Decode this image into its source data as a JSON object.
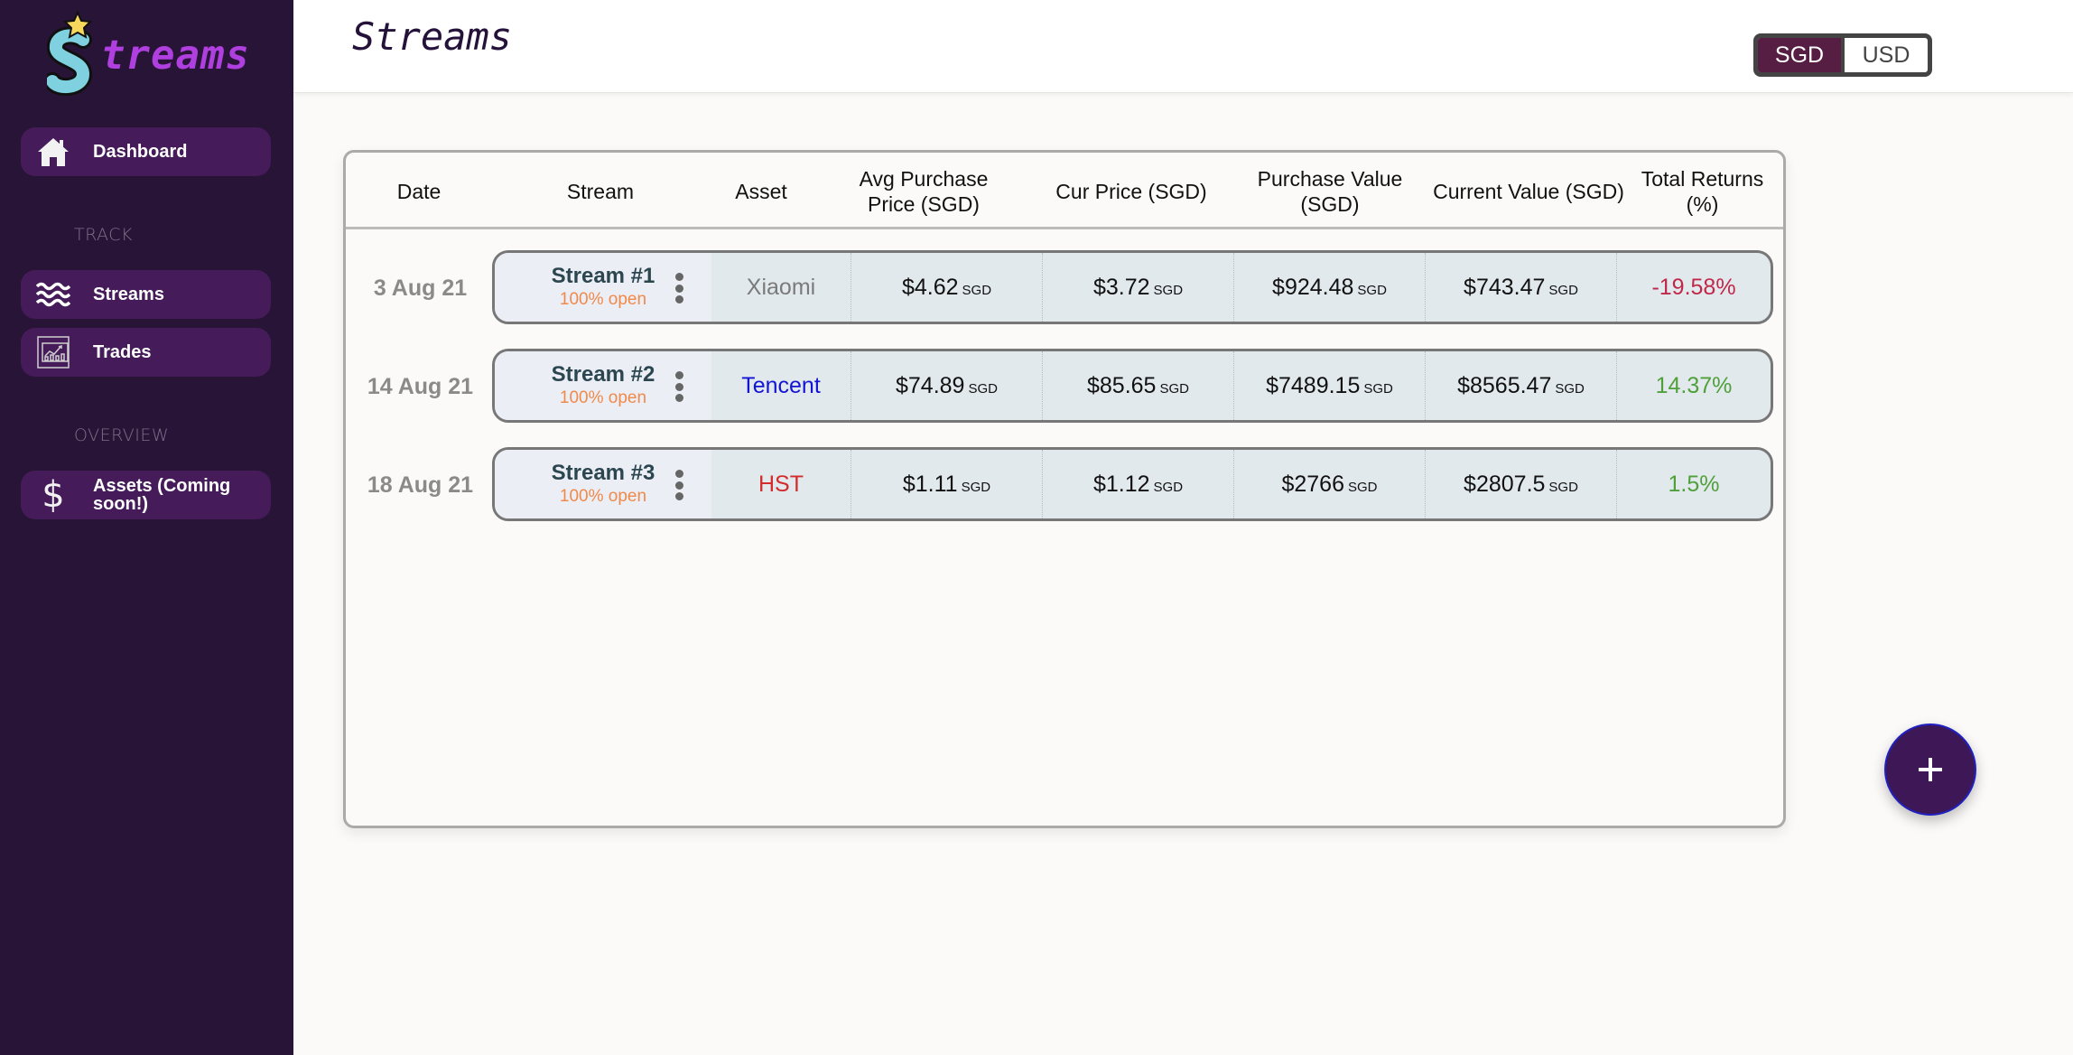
{
  "app": {
    "logo_text": "treams",
    "logo_icon": "star-s-logo-icon"
  },
  "sidebar": {
    "dashboard": {
      "label": "Dashboard",
      "icon": "home-icon"
    },
    "section_track": "TRACK",
    "streams": {
      "label": "Streams",
      "icon": "waves-icon"
    },
    "trades": {
      "label": "Trades",
      "icon": "chart-board-icon"
    },
    "section_overview": "OVERVIEW",
    "assets": {
      "label": "Assets (Coming soon!)",
      "icon": "dollar-icon"
    }
  },
  "header": {
    "title": "Streams",
    "currency_options": [
      "SGD",
      "USD"
    ],
    "currency_selected": "SGD"
  },
  "table": {
    "columns": [
      "Date",
      "Stream",
      "Asset",
      "Avg Purchase Price (SGD)",
      "Cur Price (SGD)",
      "Purchase Value (SGD)",
      "Current Value (SGD)",
      "Total Returns (%)"
    ],
    "rows": [
      {
        "date": "3 Aug 21",
        "stream": "Stream #1",
        "status": "100% open",
        "asset": "Xiaomi",
        "asset_color": "#7a7a7a",
        "avg_price": "$4.62",
        "cur_price": "$3.72",
        "purchase_value": "$924.48",
        "current_value": "$743.47",
        "unit": "SGD",
        "returns": "-19.58%",
        "returns_color": "#c0284a"
      },
      {
        "date": "14 Aug 21",
        "stream": "Stream #2",
        "status": "100% open",
        "asset": "Tencent",
        "asset_color": "#1414d4",
        "avg_price": "$74.89",
        "cur_price": "$85.65",
        "purchase_value": "$7489.15",
        "current_value": "$8565.47",
        "unit": "SGD",
        "returns": "14.37%",
        "returns_color": "#4fa03a"
      },
      {
        "date": "18 Aug 21",
        "stream": "Stream #3",
        "status": "100% open",
        "asset": "HST",
        "asset_color": "#d42b2b",
        "avg_price": "$1.11",
        "cur_price": "$1.12",
        "purchase_value": "$2766",
        "current_value": "$2807.5",
        "unit": "SGD",
        "returns": "1.5%",
        "returns_color": "#4fa03a"
      }
    ]
  },
  "fab": {
    "label": "+",
    "icon": "plus-icon"
  },
  "colors": {
    "sidebar_bg": "#281436",
    "nav_button_bg": "#451b59",
    "accent_purple": "#b03fe0",
    "toggle_active": "#561e42",
    "fab_bg": "#3e1757"
  }
}
